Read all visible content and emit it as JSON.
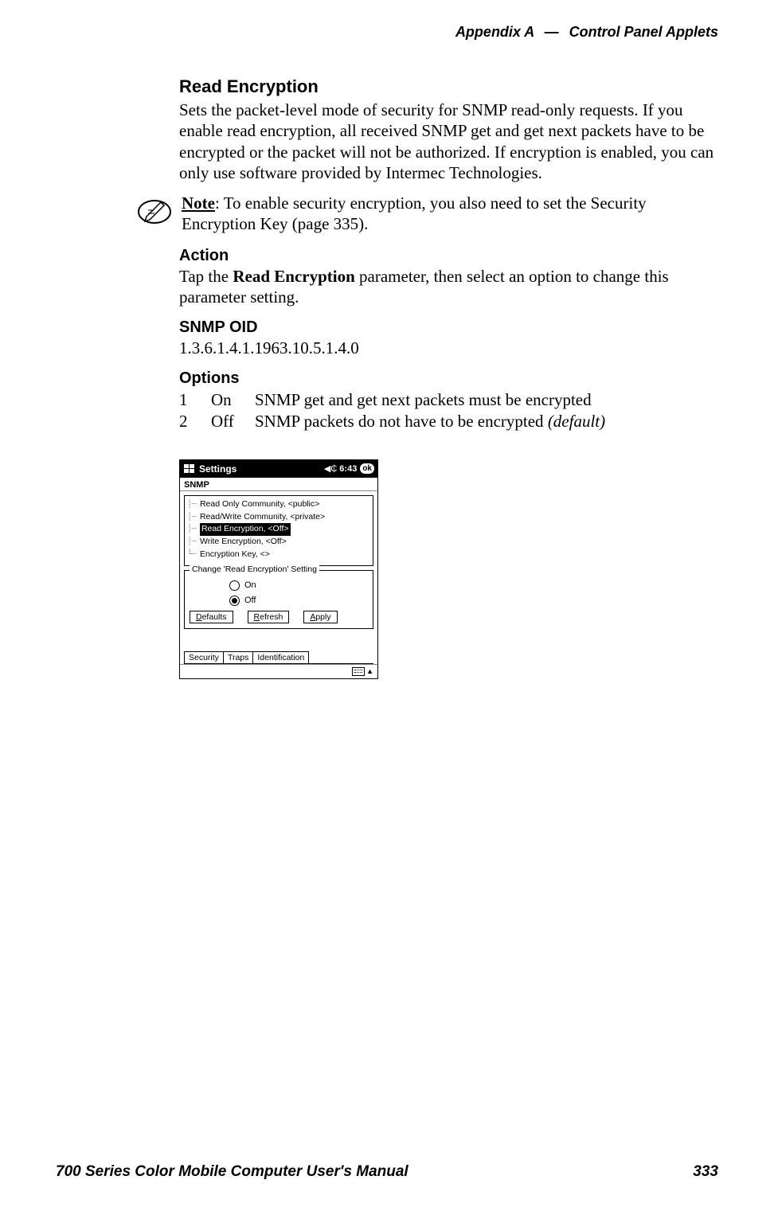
{
  "header": {
    "appendix": "Appendix A",
    "dash": "—",
    "title": "Control Panel Applets"
  },
  "section": {
    "title": "Read Encryption",
    "body": "Sets the packet-level mode of security for SNMP read-only requests. If you enable read encryption, all received SNMP get and get next packets have to be encrypted or the packet will not be authorized. If encryption is enabled, you can only use software provided by Intermec Technologies."
  },
  "note": {
    "label": "Note",
    "text": ": To enable security encryption, you also need to set the Security Encryption Key (page 335)."
  },
  "action": {
    "title": "Action",
    "body_pre": "Tap the ",
    "body_bold": "Read Encryption",
    "body_post": " parameter, then select an option to change this parameter setting."
  },
  "oid": {
    "title": "SNMP OID",
    "value": "1.3.6.1.4.1.1963.10.5.1.4.0"
  },
  "options": {
    "title": "Options",
    "rows": [
      {
        "num": "1",
        "label": "On",
        "desc": "SNMP get and get next packets must be encrypted",
        "default": ""
      },
      {
        "num": "2",
        "label": "Off",
        "desc": "SNMP packets do not have to be encrypted ",
        "default": "(default)"
      }
    ]
  },
  "device": {
    "titlebar": {
      "title": "Settings",
      "time": "6:43",
      "ok": "ok"
    },
    "subtitle": "SNMP",
    "tree": [
      {
        "label": "Read Only Community, <public>",
        "selected": false
      },
      {
        "label": "Read/Write Community, <private>",
        "selected": false
      },
      {
        "label": "Read Encryption, <Off>",
        "selected": true
      },
      {
        "label": "Write Encryption, <Off>",
        "selected": false
      },
      {
        "label": "Encryption Key, <>",
        "selected": false
      }
    ],
    "group": {
      "legend": "Change 'Read Encryption' Setting",
      "radios": [
        {
          "label": "On",
          "checked": false
        },
        {
          "label": "Off",
          "checked": true
        }
      ],
      "buttons": [
        {
          "ul": "D",
          "rest": "efaults"
        },
        {
          "ul": "R",
          "rest": "efresh"
        },
        {
          "ul": "A",
          "rest": "pply"
        }
      ]
    },
    "tabs": [
      "Security",
      "Traps",
      "Identification"
    ]
  },
  "footer": {
    "left": "700 Series Color Mobile Computer User's Manual",
    "right": "333"
  }
}
